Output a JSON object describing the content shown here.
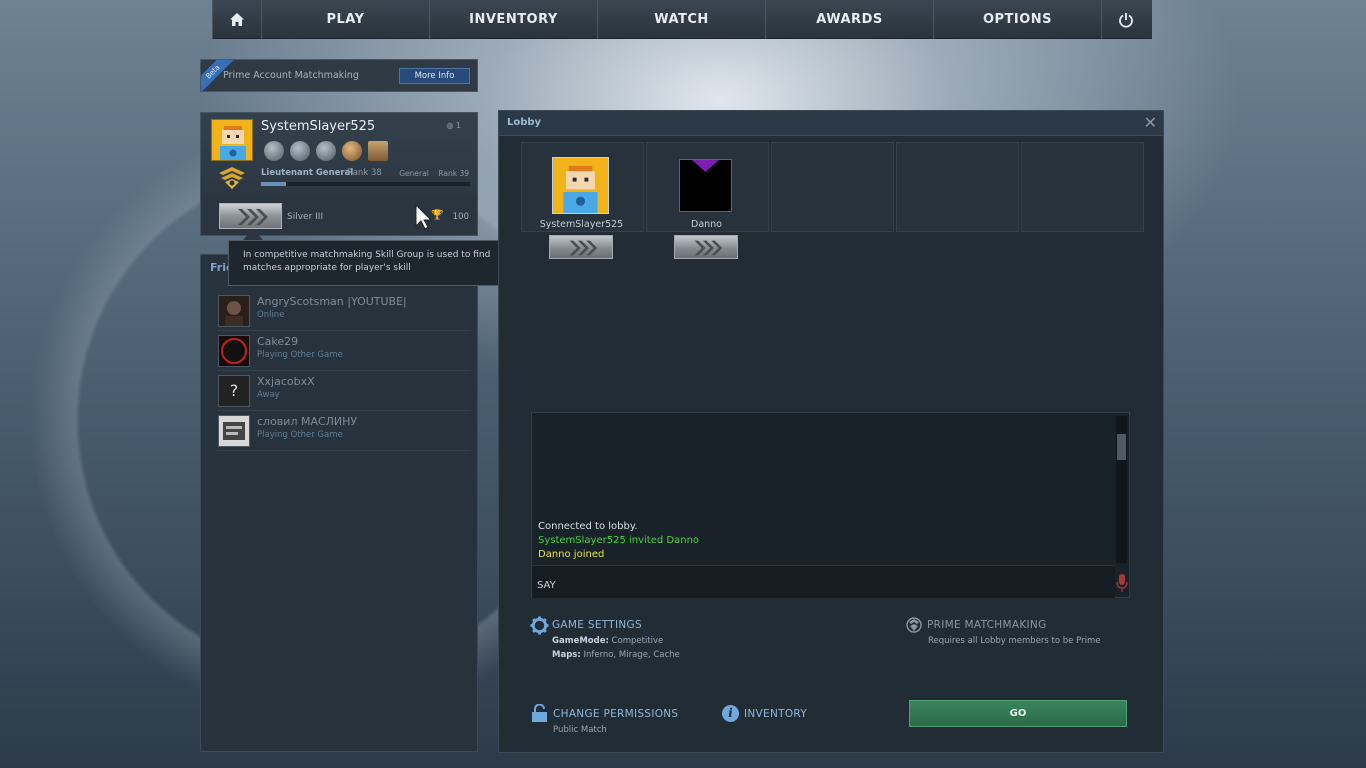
{
  "nav": {
    "home_icon": "home-icon",
    "items": [
      "PLAY",
      "INVENTORY",
      "WATCH",
      "AWARDS",
      "OPTIONS"
    ],
    "power_icon": "power-icon"
  },
  "prime_bar": {
    "beta": "Beta",
    "label": "Prime Account Matchmaking",
    "button": "More Info"
  },
  "profile": {
    "username": "SystemSlayer525",
    "friend_count": "1",
    "rank_name": "Lieutenant General",
    "rank_label": "Rank 38",
    "next_rank": "General",
    "next_rank_label": "Rank 39",
    "xp_progress": 0.12,
    "skill_group": "Silver III",
    "wins": "100"
  },
  "friends": {
    "header": "Frie",
    "list": [
      {
        "name": "AngryScotsman |YOUTUBE|",
        "status": "Online"
      },
      {
        "name": "Cake29",
        "status": "Playing Other Game"
      },
      {
        "name": "XxjacobxX",
        "status": "Away"
      },
      {
        "name": "словил МАСЛИНУ",
        "status": "Playing Other Game"
      }
    ]
  },
  "tooltip": {
    "text": "In competitive matchmaking Skill Group is used to find matches appropriate for player's skill"
  },
  "lobby": {
    "title": "Lobby",
    "members": [
      {
        "name": "SystemSlayer525"
      },
      {
        "name": "Danno"
      }
    ],
    "chat": [
      {
        "text": "Connected to lobby.",
        "color": "#d8dfe5"
      },
      {
        "text": "SystemSlayer525 invited Danno",
        "color": "#3fd33f"
      },
      {
        "text": "Danno joined",
        "color": "#e3e33a"
      }
    ],
    "say_label": "SAY",
    "game_settings": {
      "title": "GAME SETTINGS",
      "mode_label": "GameMode:",
      "mode_value": "Competitive",
      "maps_label": "Maps:",
      "maps_value": "Inferno, Mirage, Cache"
    },
    "prime_mm": {
      "title": "PRIME MATCHMAKING",
      "sub": "Requires all Lobby members to be Prime"
    },
    "permissions": {
      "title": "CHANGE PERMISSIONS",
      "sub": "Public Match"
    },
    "inventory": "INVENTORY",
    "go": "GO"
  }
}
